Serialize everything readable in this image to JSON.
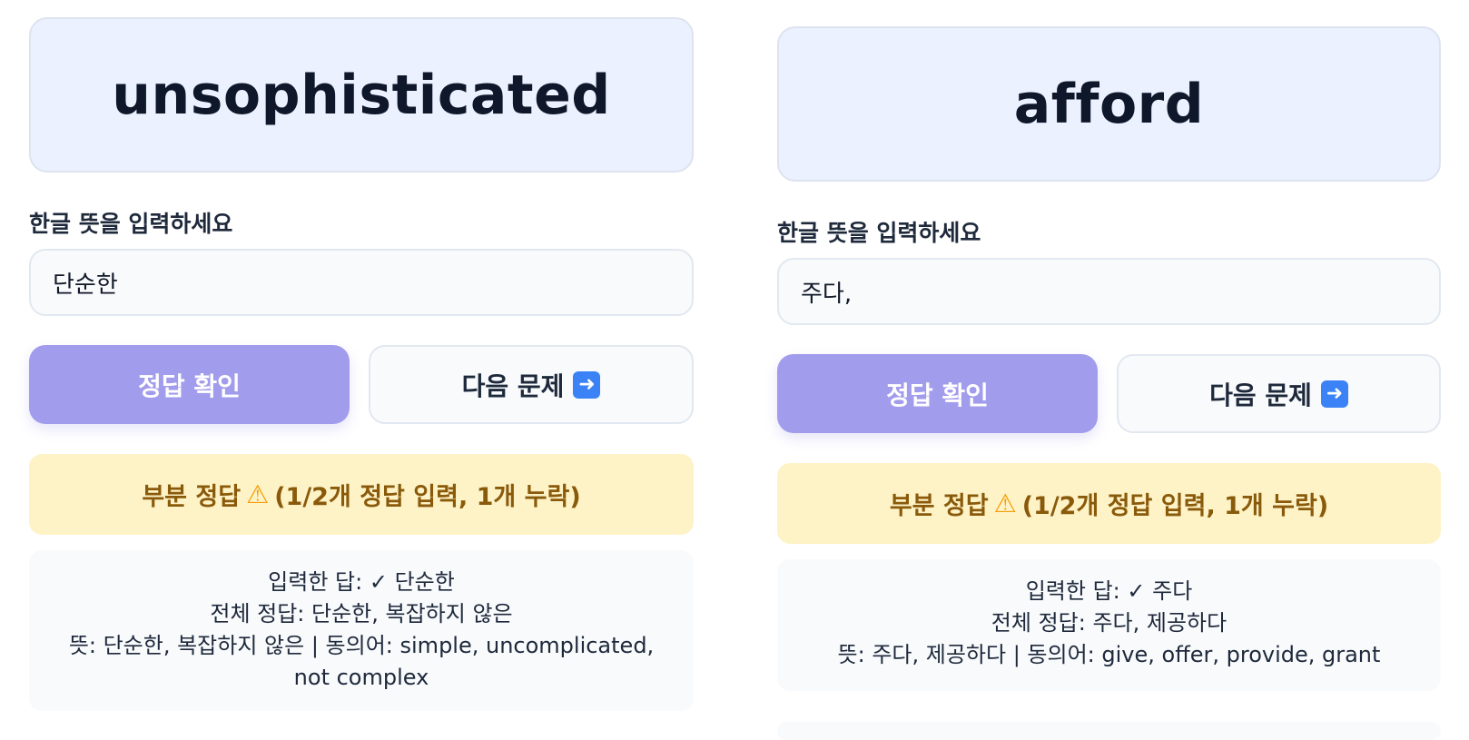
{
  "cards": [
    {
      "word": "unsophisticated",
      "prompt_label": "한글 뜻을 입력하세요",
      "input_value": "단순한",
      "check_button": "정답 확인",
      "next_button": "다음 문제",
      "next_icon": "right-arrow-emoji",
      "result": {
        "prefix": "부분 정답",
        "icon": "warning-emoji",
        "suffix": "(1/2개 정답 입력, 1개 누락)"
      },
      "details": {
        "entered": "입력한 답: ✓ 단순한",
        "all_answers": "전체 정답: 단순한, 복잡하지 않은",
        "meaning": "뜻: 단순한, 복잡하지 않은 | 동의어: simple, uncomplicated, not complex"
      }
    },
    {
      "word": "afford",
      "prompt_label": "한글 뜻을 입력하세요",
      "input_value": "주다,",
      "check_button": "정답 확인",
      "next_button": "다음 문제",
      "next_icon": "right-arrow-emoji",
      "result": {
        "prefix": "부분 정답",
        "icon": "warning-emoji",
        "suffix": "(1/2개 정답 입력, 1개 누락)"
      },
      "details": {
        "entered": "입력한 답: ✓ 주다",
        "all_answers": "전체 정답: 주다, 제공하다",
        "meaning": "뜻: 주다, 제공하다 | 동의어: give, offer, provide, grant"
      }
    }
  ],
  "colors": {
    "word_card_bg": "#ebf1ff",
    "check_button_bg": "#a29cec",
    "partial_banner_bg": "#fef3c7",
    "partial_banner_text": "#8a5a0b"
  }
}
